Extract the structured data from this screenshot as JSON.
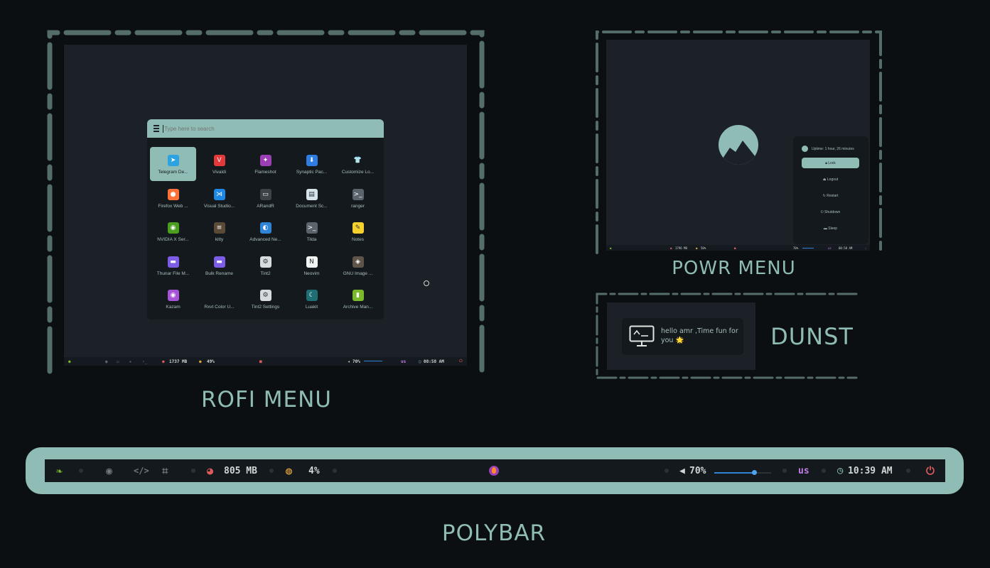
{
  "rofi": {
    "search_placeholder": "Type here to search",
    "apps": [
      {
        "label": "Telegram De...",
        "icon": "telegram-icon",
        "glyph": "➤",
        "color": "#2aa3e0"
      },
      {
        "label": "Vivaldi",
        "icon": "vivaldi-icon",
        "glyph": "V",
        "color": "#e5383b"
      },
      {
        "label": "Flameshot",
        "icon": "flameshot-icon",
        "glyph": "✦",
        "color": "#9b3fb5"
      },
      {
        "label": "Synaptic Pac...",
        "icon": "synaptic-icon",
        "glyph": "⬇",
        "color": "#2f7de1"
      },
      {
        "label": "Customize Lo...",
        "icon": "customize-look-icon",
        "glyph": "👕",
        "color": "#14191d"
      },
      {
        "label": "Firefox Web ...",
        "icon": "firefox-icon",
        "glyph": "●",
        "color": "#ff7139"
      },
      {
        "label": "Visual Studio...",
        "icon": "vscode-icon",
        "glyph": "⋊",
        "color": "#1e88e5"
      },
      {
        "label": "ARandR",
        "icon": "arandr-icon",
        "glyph": "▭",
        "color": "#3b4248"
      },
      {
        "label": "Document Sc...",
        "icon": "document-scanner-icon",
        "glyph": "▤",
        "color": "#d7e3ea"
      },
      {
        "label": "ranger",
        "icon": "ranger-icon",
        "glyph": ">_",
        "color": "#5b646a"
      },
      {
        "label": "NVIDIA X Ser...",
        "icon": "nvidia-icon",
        "glyph": "◉",
        "color": "#4c9e1f"
      },
      {
        "label": "kitty",
        "icon": "kitty-icon",
        "glyph": "≡",
        "color": "#5c4a38"
      },
      {
        "label": "Advanced Ne...",
        "icon": "network-icon",
        "glyph": "◐",
        "color": "#2f84d6"
      },
      {
        "label": "Tilda",
        "icon": "tilda-icon",
        "glyph": ">_",
        "color": "#5b646a"
      },
      {
        "label": "Notes",
        "icon": "notes-icon",
        "glyph": "✎",
        "color": "#f6d12d"
      },
      {
        "label": "Thunar File M...",
        "icon": "folder-icon",
        "glyph": "▬",
        "color": "#7d5ce6"
      },
      {
        "label": "Bulk Rename",
        "icon": "folder-icon",
        "glyph": "▬",
        "color": "#7d5ce6"
      },
      {
        "label": "Tint2",
        "icon": "tint2-icon",
        "glyph": "⚙",
        "color": "#d6dbdd"
      },
      {
        "label": "Neovim",
        "icon": "neovim-icon",
        "glyph": "N",
        "color": "#f1f5f2"
      },
      {
        "label": "GNU Image ...",
        "icon": "gimp-icon",
        "glyph": "◈",
        "color": "#5e5548"
      },
      {
        "label": "Kazam",
        "icon": "kazam-icon",
        "glyph": "◉",
        "color": "#a654d6"
      },
      {
        "label": "Rxvt Color U...",
        "icon": "",
        "glyph": "",
        "color": "transparent"
      },
      {
        "label": "Tint2 Settings",
        "icon": "tint2-settings-icon",
        "glyph": "⚙",
        "color": "#d6dbdd"
      },
      {
        "label": "Luakit",
        "icon": "luakit-icon",
        "glyph": "☾",
        "color": "#1e6f73"
      },
      {
        "label": "Archive Man...",
        "icon": "archive-manager-icon",
        "glyph": "▮",
        "color": "#7ab82c"
      }
    ],
    "bar": {
      "memory": "1737 MB",
      "cpu": "49%",
      "volume": "70%",
      "keyboard": "us",
      "time": "08:58 AM"
    }
  },
  "power_menu": {
    "uptime": "Uptime: 1 hour, 26 minutes",
    "options": [
      "Lock",
      "Logout",
      "Restart",
      "Shutdown",
      "Sleep"
    ],
    "bar": {
      "memory": "1796 MB",
      "cpu": "50%",
      "volume": "70%",
      "keyboard": "us",
      "time": "08:58 AM"
    }
  },
  "dunst": {
    "message": "hello amr ,Time fun for you 🌟"
  },
  "polybar": {
    "memory": "805 MB",
    "cpu": "4%",
    "volume": "70%",
    "volume_level": 0.7,
    "keyboard": "us",
    "time": "10:39 AM"
  },
  "captions": {
    "rofi": "ROFI MENU",
    "power": "POWR MENU",
    "dunst": "DUNST",
    "polybar": "POLYBAR"
  },
  "colors": {
    "accent": "#8fbcb5",
    "background": "#0c0f12",
    "panel": "#14191d",
    "screen": "#1b2127",
    "keyboard": "#c27ce6",
    "power": "#e05a5a"
  }
}
